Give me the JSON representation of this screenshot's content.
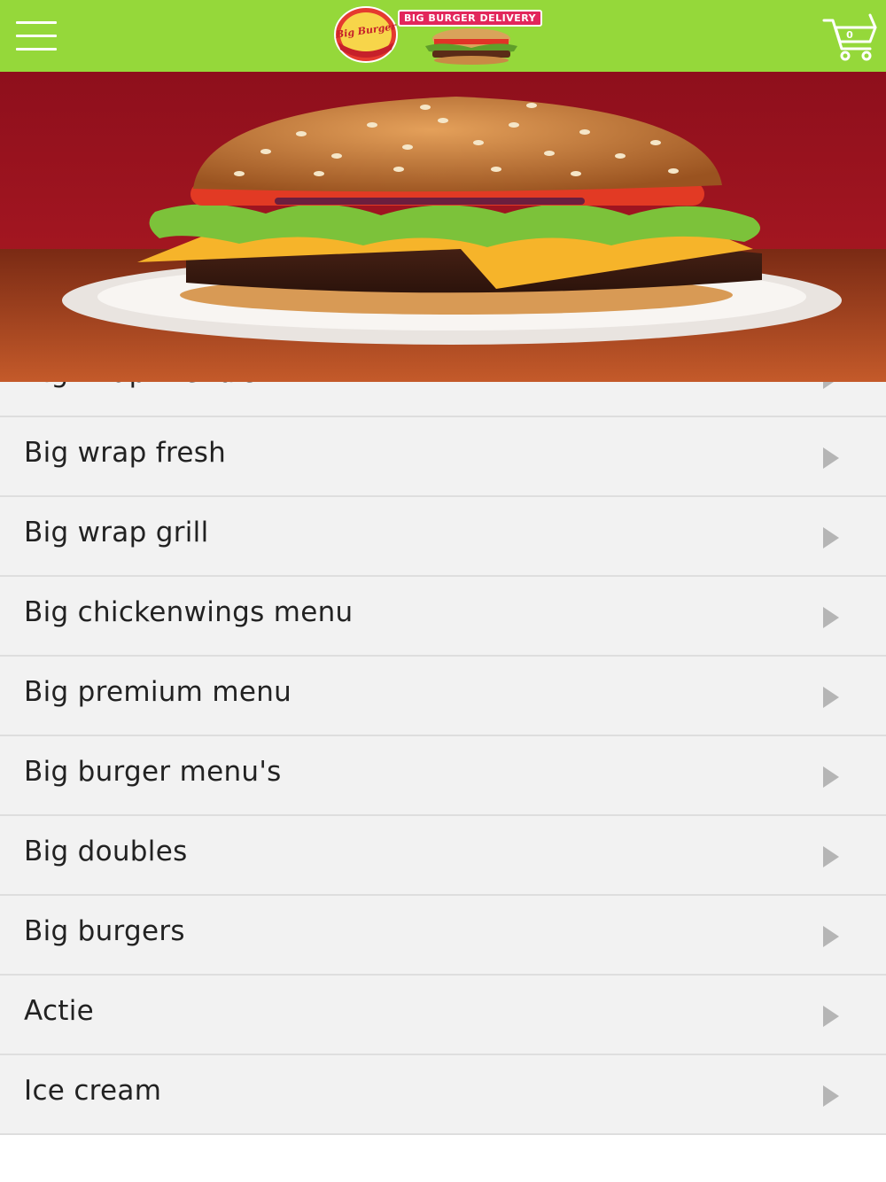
{
  "header": {
    "menu_icon": "hamburger-menu-icon",
    "logo": {
      "badge_text": "Big Burger",
      "badge_subtext": "DELIVERY",
      "banner_text": "BIG BURGER DELIVERY"
    },
    "cart": {
      "icon": "shopping-cart-icon",
      "count": "0"
    }
  },
  "hero": {
    "image": "burger-photo"
  },
  "menu": {
    "items": [
      {
        "label": "Big wrap menu's"
      },
      {
        "label": "Big wrap fresh"
      },
      {
        "label": "Big wrap grill"
      },
      {
        "label": "Big chickenwings menu"
      },
      {
        "label": "Big premium menu"
      },
      {
        "label": "Big burger menu's"
      },
      {
        "label": "Big doubles"
      },
      {
        "label": "Big burgers"
      },
      {
        "label": "Actie"
      },
      {
        "label": "Ice cream"
      }
    ]
  },
  "colors": {
    "topbar": "#95d83a",
    "list_bg": "#f2f2f2",
    "divider": "#dedede",
    "arrow": "#b5b5b5",
    "text": "#222222"
  }
}
